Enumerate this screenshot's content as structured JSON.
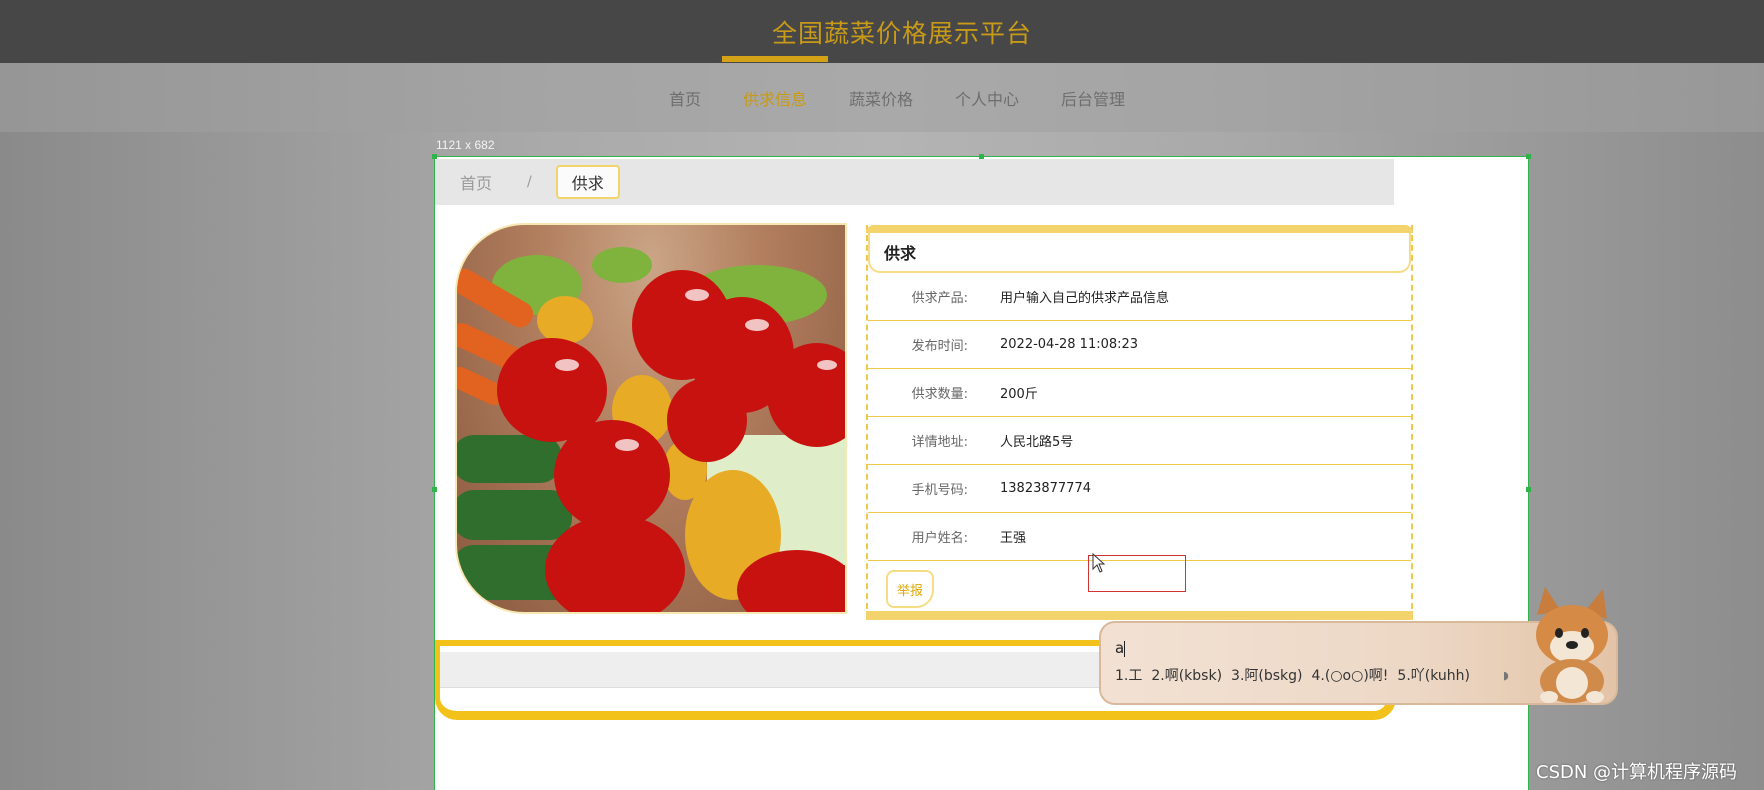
{
  "header": {
    "title": "全国蔬菜价格展示平台"
  },
  "nav": {
    "items": [
      {
        "label": "首页"
      },
      {
        "label": "供求信息"
      },
      {
        "label": "蔬菜价格"
      },
      {
        "label": "个人中心"
      },
      {
        "label": "后台管理"
      }
    ],
    "active_index": 1
  },
  "frame_dimension_label": "1121 x 682",
  "breadcrumb": {
    "home": "首页",
    "separator": "/",
    "current": "供求"
  },
  "detail": {
    "heading": "供求",
    "rows": [
      {
        "label": "供求产品:",
        "value": "用户输入自己的供求产品信息"
      },
      {
        "label": "发布时间:",
        "value": "2022-04-28 11:08:23"
      },
      {
        "label": "供求数量:",
        "value": "200斤"
      },
      {
        "label": "详情地址:",
        "value": "人民北路5号"
      },
      {
        "label": "手机号码:",
        "value": "13823877774"
      },
      {
        "label": "用户姓名:",
        "value": "王强"
      }
    ],
    "report_label": "举报"
  },
  "ime": {
    "input": "a",
    "candidates": [
      "1.工",
      "2.啊(kbsk)",
      "3.阿(bskg)",
      "4.(○o○)啊!",
      "5.吖(kuhh)"
    ]
  },
  "watermark": "CSDN @计算机程序源码",
  "colors": {
    "accent": "#c89a17",
    "highlight": "#f2c21b",
    "frame": "#2fb34a"
  }
}
